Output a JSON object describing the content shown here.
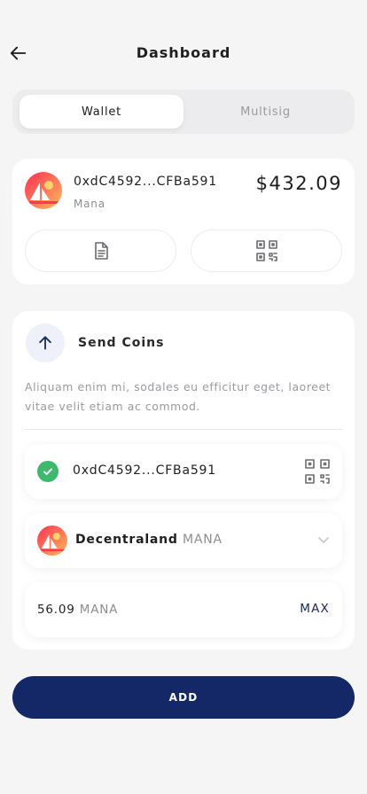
{
  "header": {
    "title": "Dashboard",
    "back_icon": "arrow-left-icon"
  },
  "tabs": [
    {
      "label": "Wallet",
      "active": true
    },
    {
      "label": "Multisig",
      "active": false
    }
  ],
  "wallet": {
    "address": "0xdC4592...CFBa591",
    "token_name": "Mana",
    "balance": "$432.09",
    "actions": [
      {
        "icon": "document-icon"
      },
      {
        "icon": "qr-scan-icon"
      }
    ]
  },
  "send": {
    "title": "Send Coins",
    "icon": "arrow-up-icon",
    "description": "Aliquam enim mi, sodales eu efficitur eget, laoreet vitae velit etiam ac commod.",
    "recipient": {
      "address": "0xdC4592...CFBa591",
      "status_icon": "check-circle-icon",
      "scan_icon": "qr-scan-icon"
    },
    "token": {
      "name": "Decentraland",
      "symbol": "MANA",
      "dropdown_icon": "chevron-down-icon"
    },
    "amount": {
      "value": "56.09",
      "unit": "MANA",
      "max_label": "MAX"
    }
  },
  "add_button": {
    "label": "ADD"
  },
  "colors": {
    "primary": "#142766",
    "success": "#3cb96b",
    "background": "#f5f5f6"
  }
}
